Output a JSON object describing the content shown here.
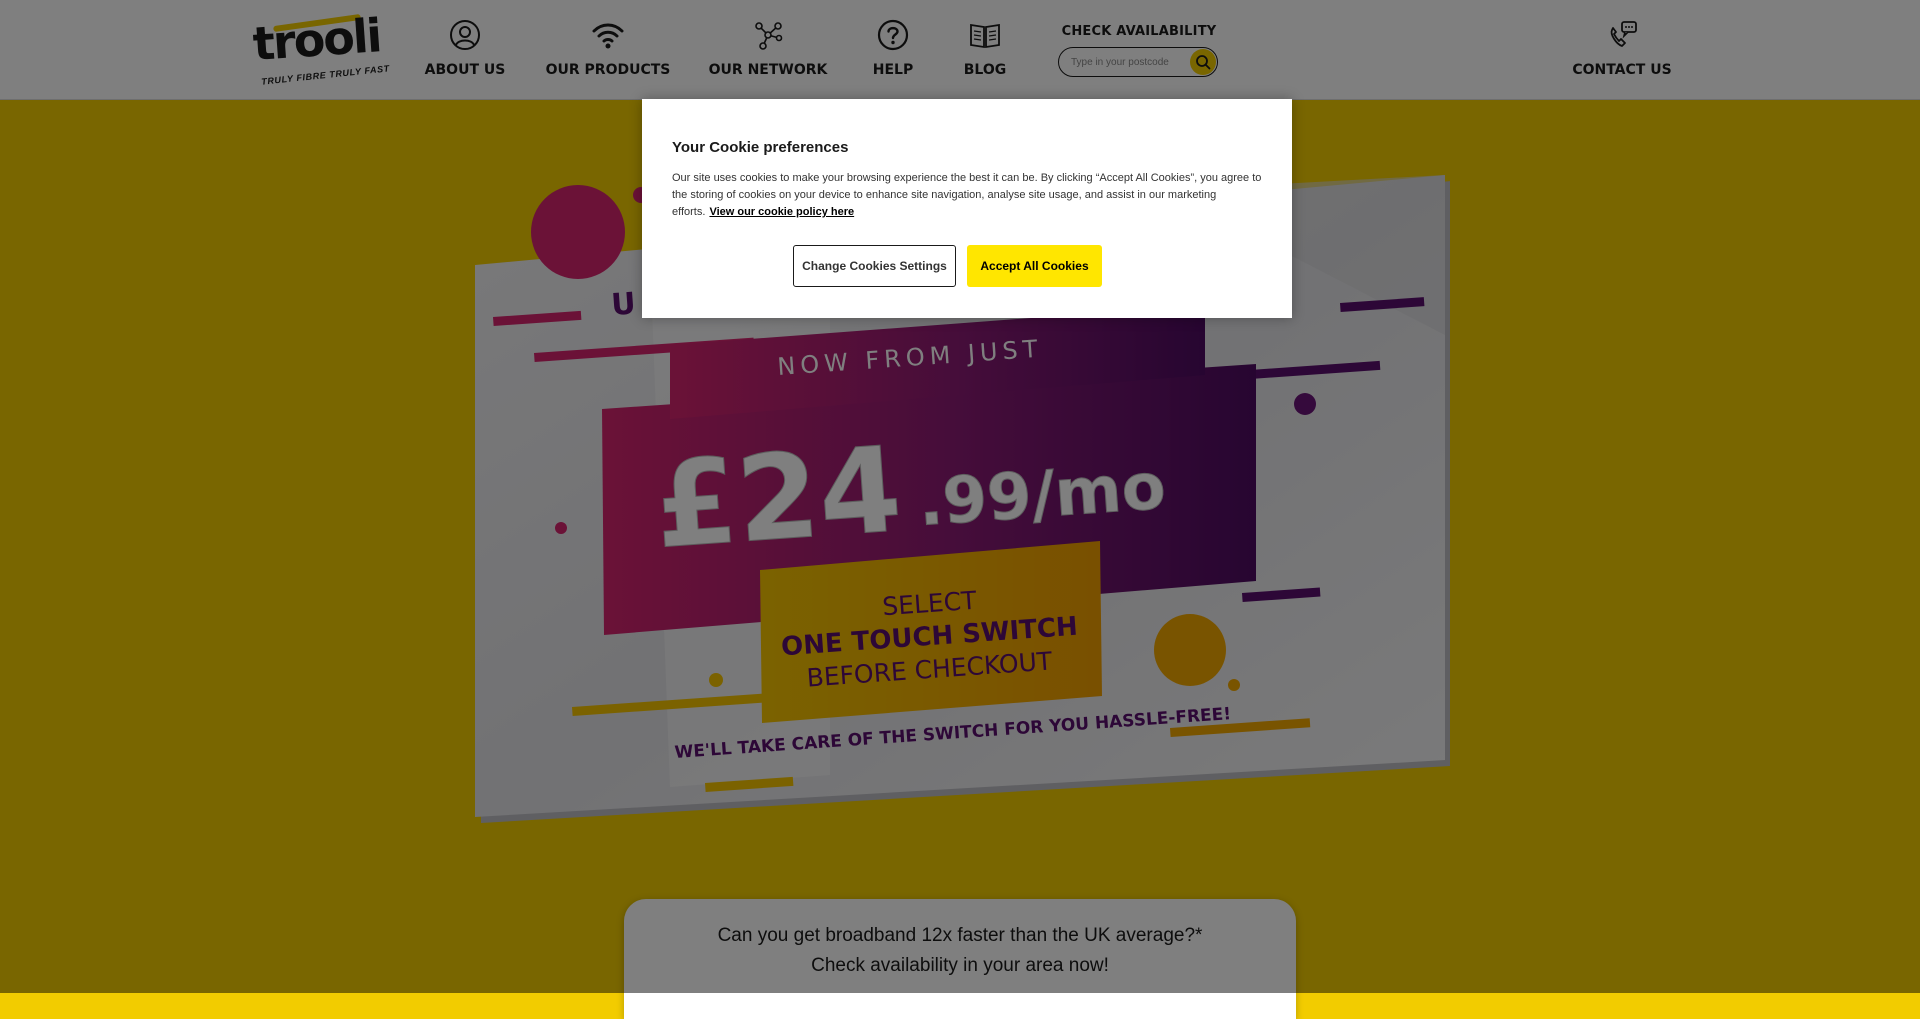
{
  "colors": {
    "brand_yellow": "#F2CC00",
    "button_yellow": "#FFE600",
    "magenta": "#D6246E",
    "purple": "#5B0F6E",
    "text_dark": "#1A1A1A"
  },
  "logo": {
    "wordmark": "trooli",
    "tagline": "TRULY FIBRE TRULY FAST"
  },
  "nav": {
    "items": [
      {
        "label": "ABOUT US",
        "icon": "user-circle-icon"
      },
      {
        "label": "OUR PRODUCTS",
        "icon": "wifi-icon"
      },
      {
        "label": "OUR NETWORK",
        "icon": "network-icon"
      },
      {
        "label": "HELP",
        "icon": "help-circle-icon"
      },
      {
        "label": "BLOG",
        "icon": "book-icon"
      }
    ],
    "check_availability": {
      "title": "CHECK AVAILABILITY",
      "placeholder": "Type in your postcode",
      "search_icon": "search-icon"
    },
    "contact": {
      "label": "CONTACT US",
      "icon": "phone-chat-icon"
    }
  },
  "hero": {
    "partial_heading": "U",
    "now_from": "NOW FROM JUST",
    "price_main": "£24",
    "price_suffix": ".99/mo",
    "select_line1": "SELECT",
    "select_line2": "ONE TOUCH SWITCH",
    "select_line3": "BEFORE CHECKOUT",
    "tagline": "WE'LL TAKE CARE OF THE SWITCH FOR YOU HASSLE-FREE!"
  },
  "cta": {
    "line1": "Can you get broadband 12x faster than the UK average?*",
    "line2": "Check availability in your area now!"
  },
  "cookie": {
    "title": "Your Cookie preferences",
    "body": "Our site uses cookies to make your browsing experience the best it can be. By clicking “Accept All Cookies”, you agree to the storing of cookies on your device to enhance site navigation, analyse site usage, and assist in our marketing efforts.",
    "link": "View our cookie policy here",
    "settings_button": "Change Cookies Settings",
    "accept_button": "Accept All Cookies"
  }
}
